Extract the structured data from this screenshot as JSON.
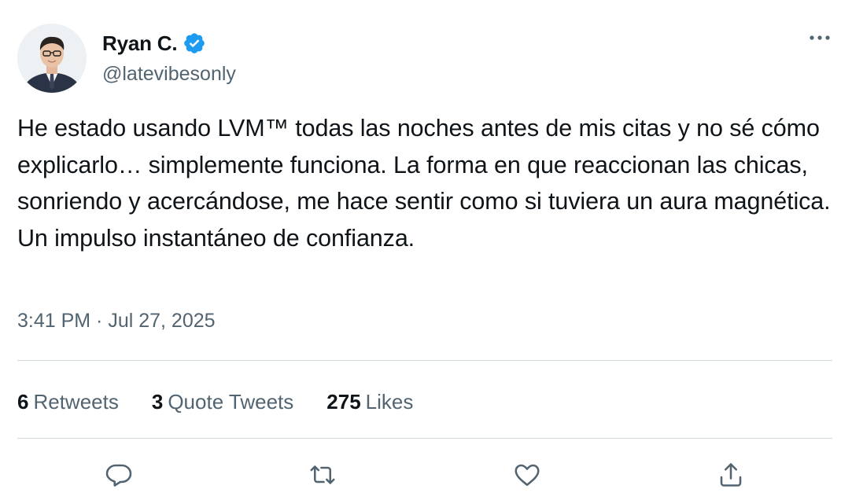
{
  "author": {
    "name": "Ryan C.",
    "handle": "@latevibesonly",
    "verified": true,
    "avatar_icon": "profile-photo"
  },
  "tweet": {
    "text": "He estado usando LVM™ todas las noches antes de mis citas y no sé cómo explicarlo… simplemente funciona. La forma en que reaccionan las chicas, sonriendo y acercándose, me hace sentir como si tuviera un aura magnética. Un impulso instantáneo de confianza.",
    "timestamp": "3:41 PM · Jul 27, 2025"
  },
  "stats": {
    "retweets": {
      "count": "6",
      "label": "Retweets"
    },
    "quotes": {
      "count": "3",
      "label": "Quote Tweets"
    },
    "likes": {
      "count": "275",
      "label": "Likes"
    }
  },
  "actions": [
    {
      "name": "reply",
      "icon": "reply-bubble-icon"
    },
    {
      "name": "retweet",
      "icon": "retweet-arrows-icon"
    },
    {
      "name": "like",
      "icon": "heart-icon"
    },
    {
      "name": "share",
      "icon": "share-upload-icon"
    }
  ],
  "menu": {
    "icon": "more-dots-icon"
  },
  "colors": {
    "primary_text": "#0f1419",
    "secondary_text": "#536471",
    "verified_blue": "#1d9bf0",
    "divider": "#cfd9de"
  }
}
